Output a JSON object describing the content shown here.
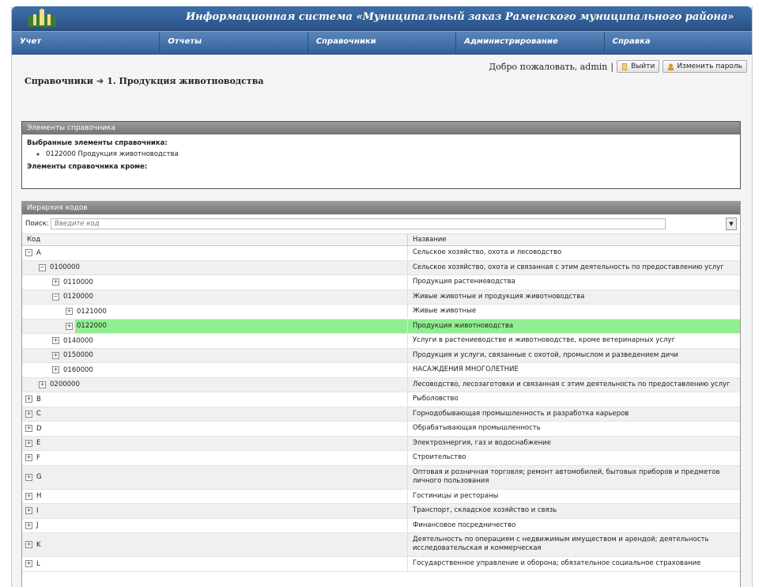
{
  "header": {
    "title": "Информационная система «Муниципальный заказ Раменского муниципального района»"
  },
  "menu": [
    {
      "label": "Учет"
    },
    {
      "label": "Отчеты"
    },
    {
      "label": "Справочники"
    },
    {
      "label": "Администрирование"
    },
    {
      "label": "Справка"
    }
  ],
  "user": {
    "welcome": "Добро пожаловать, admin",
    "separator": "|",
    "logout_label": "Выйти",
    "change_password_label": "Изменить пароль"
  },
  "breadcrumb": {
    "root": "Справочники",
    "current": "1. Продукция животноводства"
  },
  "elements_panel": {
    "title": "Элементы справочника",
    "selected_label": "Выбранные элементы справочника:",
    "selected_items": [
      "0122000 Продукция животноводства"
    ],
    "except_label": "Элементы справочника кроме:"
  },
  "hierarchy_panel": {
    "title": "Иерархия кодов",
    "search_label": "Поиск:",
    "search_placeholder": "Введите код",
    "columns": {
      "code": "Код",
      "name": "Название"
    },
    "rows": [
      {
        "code": "A",
        "name": "Сельское хозяйство, охота и лесоводство",
        "level": 0,
        "expanded": true
      },
      {
        "code": "0100000",
        "name": "Сельское хозяйство, охота и связанная с этим деятельность по предоставлению услуг",
        "level": 1,
        "expanded": true
      },
      {
        "code": "0110000",
        "name": "Продукция растениеводства",
        "level": 2,
        "expanded": false
      },
      {
        "code": "0120000",
        "name": "Живые животные и продукция животноводства",
        "level": 2,
        "expanded": true
      },
      {
        "code": "0121000",
        "name": "Живые животные",
        "level": 3,
        "expanded": false
      },
      {
        "code": "0122000",
        "name": "Продукция животноводства",
        "level": 3,
        "expanded": false,
        "selected": true
      },
      {
        "code": "0140000",
        "name": "Услуги в растениеводстве и животноводстве, кроме ветеринарных услуг",
        "level": 2,
        "expanded": false
      },
      {
        "code": "0150000",
        "name": "Продукция и услуги, связанные с охотой, промыслом и разведением дичи",
        "level": 2,
        "expanded": false
      },
      {
        "code": "0160000",
        "name": "НАСАЖДЕНИЯ МНОГОЛЕТНИЕ",
        "level": 2,
        "expanded": false
      },
      {
        "code": "0200000",
        "name": "Лесоводство, лесозаготовки и связанная с этим деятельность по предоставлению услуг",
        "level": 1,
        "expanded": false
      },
      {
        "code": "B",
        "name": "Рыболовство",
        "level": 0,
        "expanded": false
      },
      {
        "code": "C",
        "name": "Горнодобывающая промышленность и разработка карьеров",
        "level": 0,
        "expanded": false
      },
      {
        "code": "D",
        "name": "Обрабатывающая промышленность",
        "level": 0,
        "expanded": false
      },
      {
        "code": "E",
        "name": "Электроэнергия, газ и водоснабжение",
        "level": 0,
        "expanded": false
      },
      {
        "code": "F",
        "name": "Строительство",
        "level": 0,
        "expanded": false
      },
      {
        "code": "G",
        "name": "Оптовая и розничная торговля; ремонт автомобилей, бытовых приборов и предметов личного пользования",
        "level": 0,
        "expanded": false
      },
      {
        "code": "H",
        "name": "Гостиницы и рестораны",
        "level": 0,
        "expanded": false
      },
      {
        "code": "I",
        "name": "Транспорт, складское хозяйство и связь",
        "level": 0,
        "expanded": false
      },
      {
        "code": "J",
        "name": "Финансовое посредничество",
        "level": 0,
        "expanded": false
      },
      {
        "code": "K",
        "name": "Деятельность по операциям с недвижимым имуществом и арендой; деятельность исследовательская и коммерческая",
        "level": 0,
        "expanded": false
      },
      {
        "code": "L",
        "name": "Государственное управление и оборона; обязательное социальное страхование",
        "level": 0,
        "expanded": false
      }
    ]
  },
  "colors": {
    "banner": "#2a5288",
    "selected_row": "#90ee90",
    "panel_header": "#8a8a8a"
  }
}
